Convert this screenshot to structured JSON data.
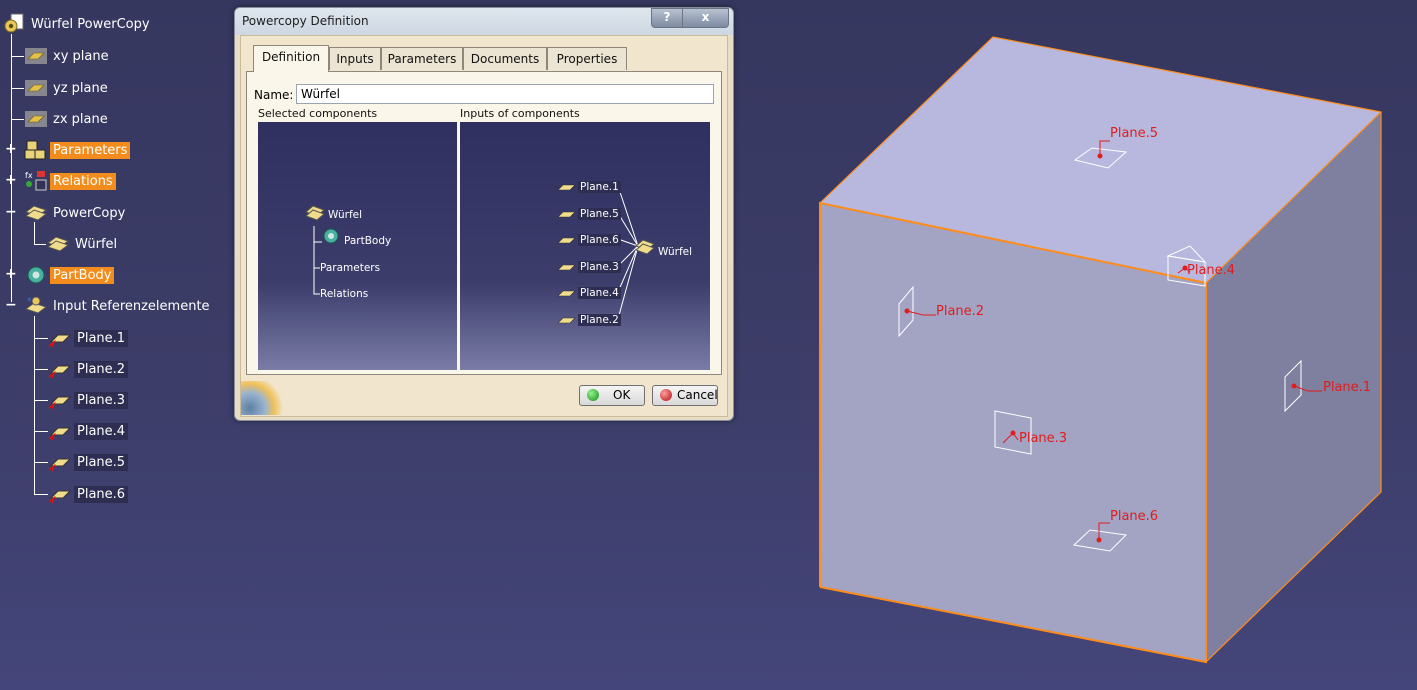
{
  "tree": {
    "root": "Würfel PowerCopy",
    "items": [
      {
        "label": "xy plane",
        "icon": "plane-icon"
      },
      {
        "label": "yz plane",
        "icon": "plane-icon"
      },
      {
        "label": "zx plane",
        "icon": "plane-icon"
      },
      {
        "label": "Parameters",
        "icon": "parameters-icon",
        "highlight": true
      },
      {
        "label": "Relations",
        "icon": "relations-icon",
        "highlight": true
      },
      {
        "label": "PowerCopy",
        "icon": "powercopy-icon"
      },
      {
        "label": "Würfel",
        "icon": "powercopy-item-icon"
      },
      {
        "label": "PartBody",
        "icon": "partbody-icon",
        "highlight": true
      },
      {
        "label": "Input Referenzelemente",
        "icon": "input-ref-icon"
      },
      {
        "label": "Plane.1",
        "icon": "plane-feature-icon"
      },
      {
        "label": "Plane.2",
        "icon": "plane-feature-icon"
      },
      {
        "label": "Plane.3",
        "icon": "plane-feature-icon"
      },
      {
        "label": "Plane.4",
        "icon": "plane-feature-icon"
      },
      {
        "label": "Plane.5",
        "icon": "plane-feature-icon"
      },
      {
        "label": "Plane.6",
        "icon": "plane-feature-icon"
      }
    ]
  },
  "dialog": {
    "title": "Powercopy Definition",
    "help_label": "?",
    "close_label": "x",
    "tabs": [
      "Definition",
      "Inputs",
      "Parameters",
      "Documents",
      "Properties"
    ],
    "active_tab": "Definition",
    "name_label": "Name:",
    "name_value": "Würfel",
    "selected_components_caption": "Selected components",
    "inputs_caption": "Inputs of components",
    "selected_components": {
      "root": "Würfel",
      "children": [
        "PartBody",
        "Parameters",
        "Relations"
      ]
    },
    "inputs": [
      "Plane.1",
      "Plane.5",
      "Plane.6",
      "Plane.3",
      "Plane.4",
      "Plane.2"
    ],
    "inputs_target": "Würfel",
    "ok_label": "OK",
    "cancel_label": "Cancel"
  },
  "viewport": {
    "plane_labels": [
      "Plane.5",
      "Plane.4",
      "Plane.2",
      "Plane.1",
      "Plane.3",
      "Plane.6"
    ],
    "colors": {
      "background": "#3a3b66",
      "cube_top": "#b8b8de",
      "cube_front": "#a3a3c4",
      "cube_right": "#7f809f",
      "edge_highlight": "#ff8c1a",
      "annotation": "#e01c1c"
    }
  }
}
